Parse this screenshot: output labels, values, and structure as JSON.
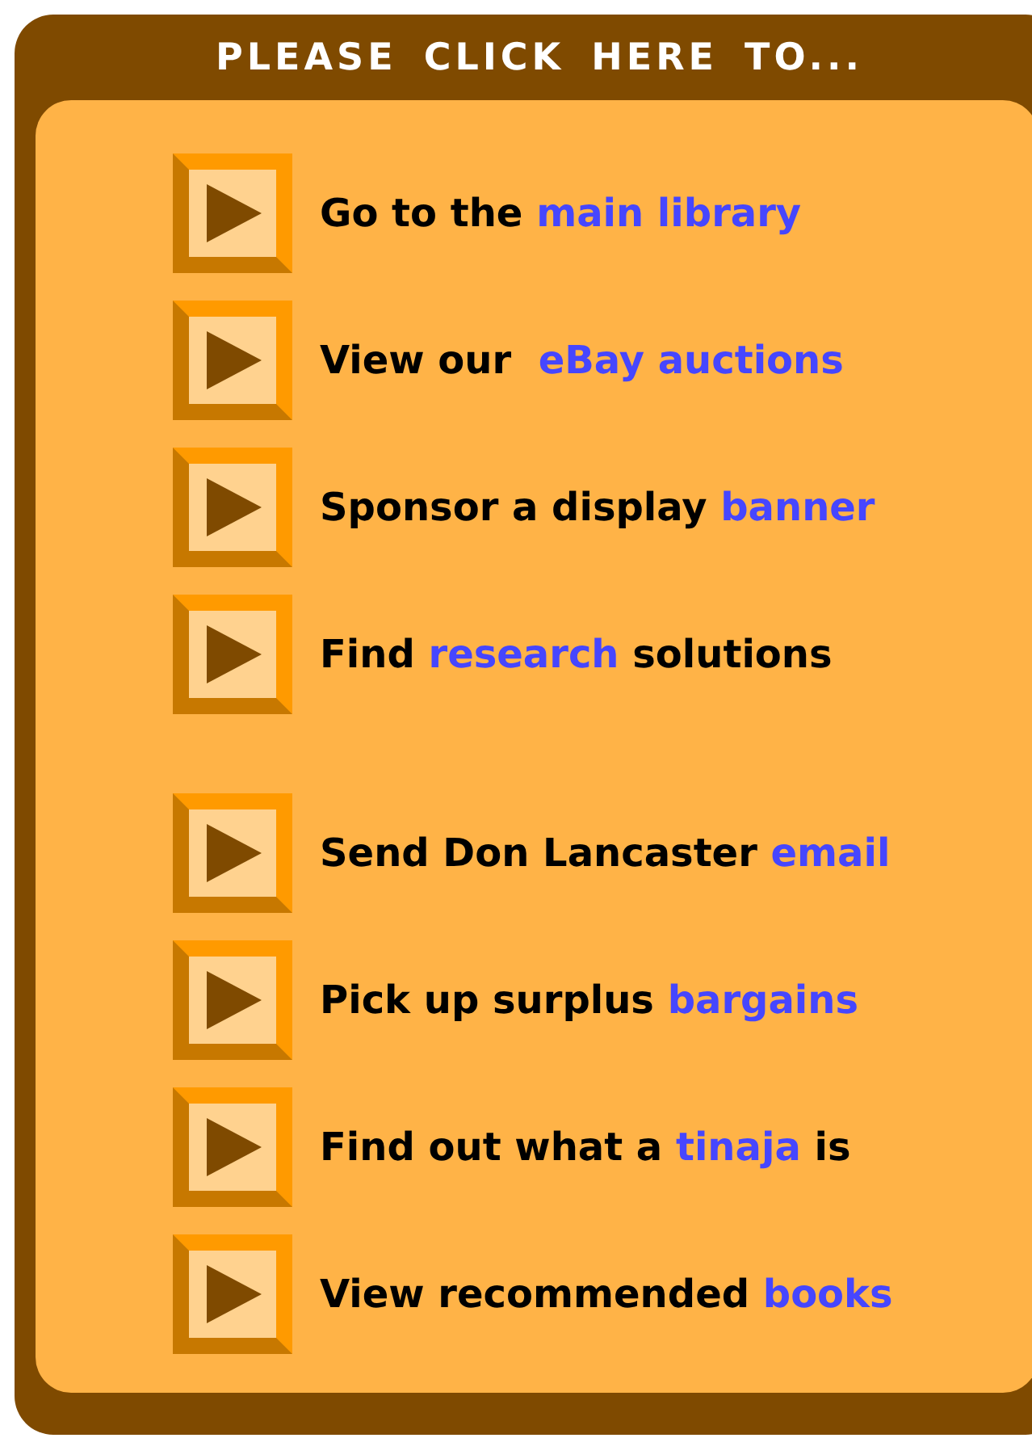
{
  "header": {
    "title": "PLEASE CLICK HERE TO..."
  },
  "groups": [
    {
      "items": [
        {
          "before": "Go to the ",
          "link": "main library"
        },
        {
          "before": "View our  ",
          "link": "eBay auctions"
        },
        {
          "before": "Sponsor a display ",
          "link": "banner"
        },
        {
          "before": "Find ",
          "link": "research",
          "after": " solutions"
        }
      ]
    },
    {
      "items": [
        {
          "before": "Send Don Lancaster ",
          "link": "email"
        },
        {
          "before": "Pick up surplus ",
          "link": "bargains"
        },
        {
          "before": "Find out what a ",
          "link": "tinaja",
          "after": " is"
        },
        {
          "before": "View recommended ",
          "link": "books"
        }
      ]
    }
  ]
}
